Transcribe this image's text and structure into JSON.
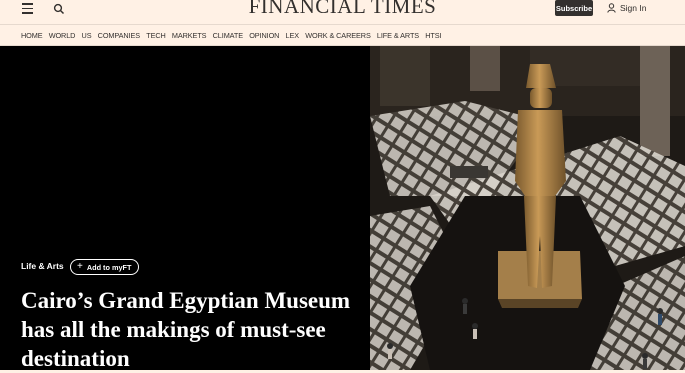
{
  "header": {
    "logo": "FINANCIAL TIMES",
    "subscribe_label": "Subscribe",
    "signin_label": "Sign In"
  },
  "nav": {
    "items": [
      "HOME",
      "WORLD",
      "US",
      "COMPANIES",
      "TECH",
      "MARKETS",
      "CLIMATE",
      "OPINION",
      "LEX",
      "WORK & CAREERS",
      "LIFE & ARTS",
      "HTSI"
    ]
  },
  "hero": {
    "topic": "Life & Arts",
    "add_myft_label": "Add to myFT",
    "headline": "Cairo’s Grand Egyptian Museum has all the makings of must-see destination"
  },
  "colors": {
    "background": "#fff1e5",
    "ink": "#33302e",
    "hero_bg": "#000000"
  },
  "icons": [
    "menu-icon",
    "search-icon",
    "user-icon",
    "plus-icon"
  ]
}
